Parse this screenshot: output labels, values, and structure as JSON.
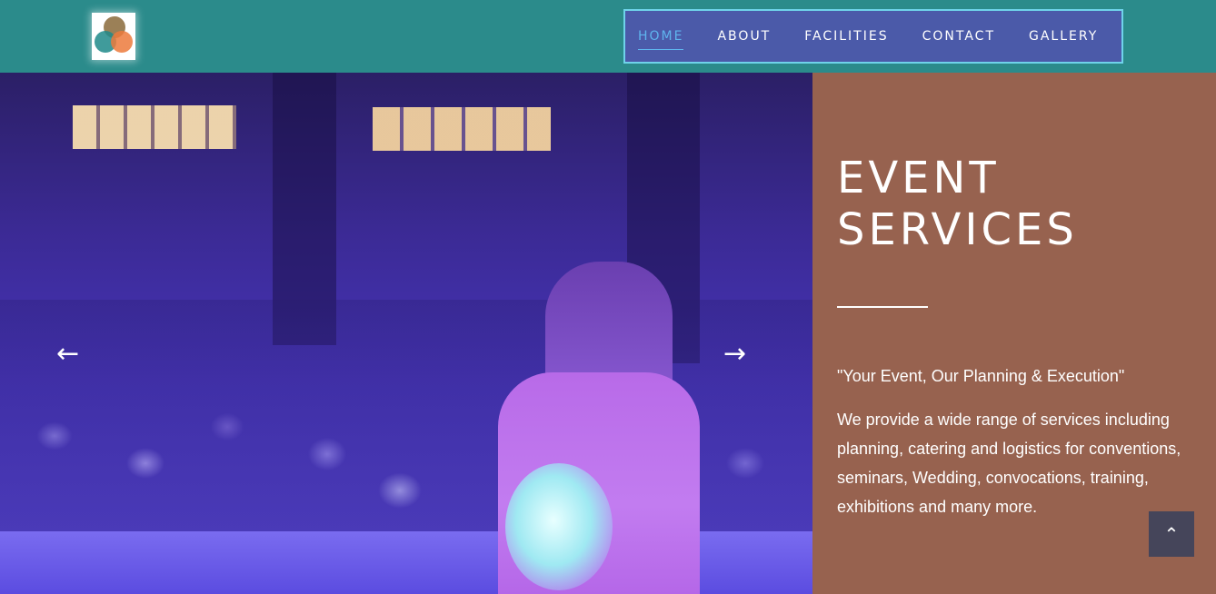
{
  "brand": {
    "logo": "logo-circles-icon"
  },
  "nav": {
    "items": [
      {
        "label": "HOME",
        "active": true
      },
      {
        "label": "ABOUT",
        "active": false
      },
      {
        "label": "FACILITIES",
        "active": false
      },
      {
        "label": "CONTACT",
        "active": false
      },
      {
        "label": "GALLERY",
        "active": false
      }
    ],
    "colors": {
      "bar": "#2b8b8b",
      "menu": "#4b5aa9",
      "active": "#5fb4ee"
    }
  },
  "slider": {
    "prev_icon": "←",
    "next_icon": "→"
  },
  "panel": {
    "title": "EVENT SERVICES",
    "quote": "\"Your Event, Our Planning & Execution\"",
    "description": "We provide a wide range of services including planning, catering and logistics for conventions, seminars, Wedding, convocations, training, exhibitions and many more.",
    "background": "#97624f"
  },
  "scroll_top": {
    "icon": "⌃"
  }
}
